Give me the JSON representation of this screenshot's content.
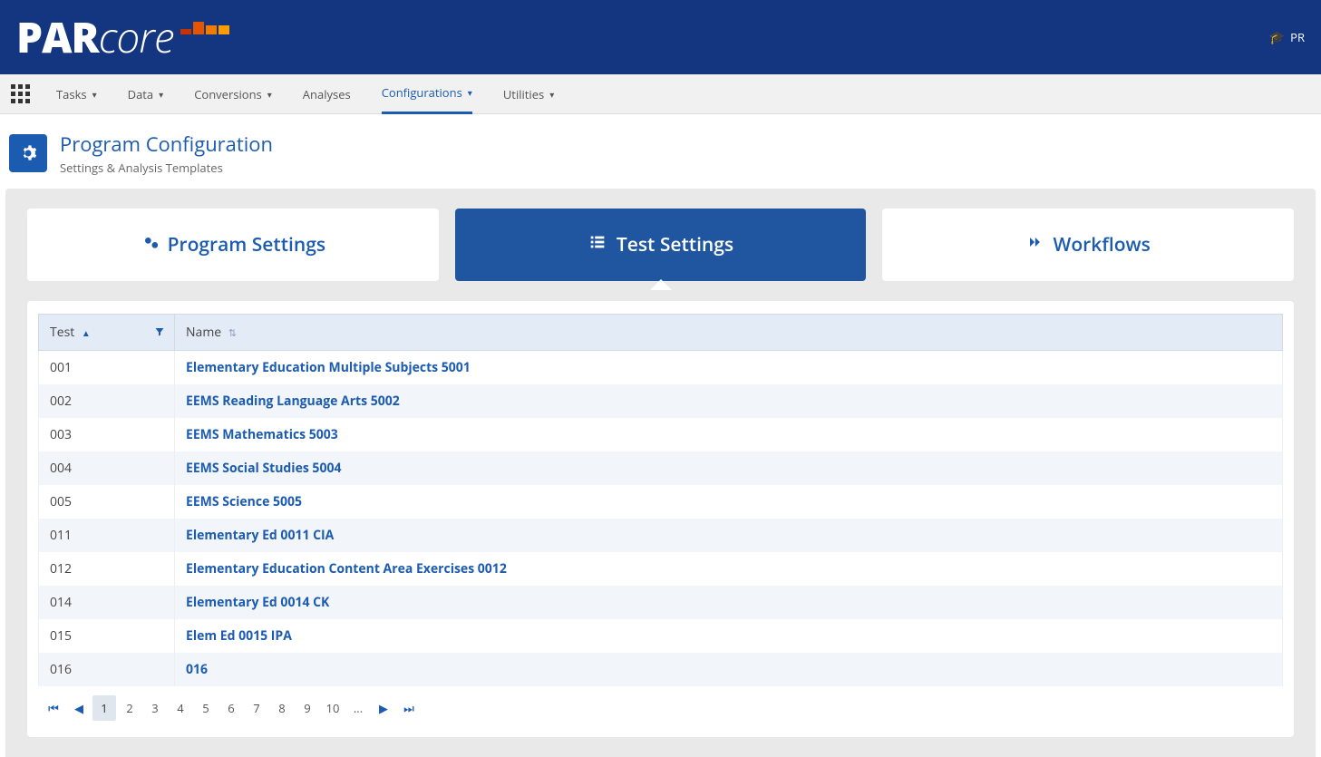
{
  "banner": {
    "logo_par": "PAR",
    "logo_core": "core",
    "user_label": "PR"
  },
  "menu": {
    "items": [
      {
        "label": "Tasks",
        "chev": true
      },
      {
        "label": "Data",
        "chev": true
      },
      {
        "label": "Conversions",
        "chev": true
      },
      {
        "label": "Analyses",
        "chev": false
      },
      {
        "label": "Configurations",
        "chev": true,
        "active": true
      },
      {
        "label": "Utilities",
        "chev": true
      }
    ]
  },
  "page": {
    "title": "Program Configuration",
    "subtitle": "Settings & Analysis Templates"
  },
  "tabs": [
    {
      "label": "Program Settings",
      "icon": "gears-icon"
    },
    {
      "label": "Test Settings",
      "icon": "list-icon",
      "active": true
    },
    {
      "label": "Workflows",
      "icon": "chevrons-icon"
    }
  ],
  "table": {
    "columns": {
      "test": "Test",
      "name": "Name"
    },
    "rows": [
      {
        "test": "001",
        "name": "Elementary Education Multiple Subjects 5001"
      },
      {
        "test": "002",
        "name": "EEMS Reading Language Arts 5002"
      },
      {
        "test": "003",
        "name": "EEMS Mathematics 5003"
      },
      {
        "test": "004",
        "name": "EEMS Social Studies 5004"
      },
      {
        "test": "005",
        "name": "EEMS Science 5005"
      },
      {
        "test": "011",
        "name": "Elementary Ed 0011 CIA"
      },
      {
        "test": "012",
        "name": "Elementary Education Content Area Exercises 0012"
      },
      {
        "test": "014",
        "name": "Elementary Ed 0014 CK"
      },
      {
        "test": "015",
        "name": "Elem Ed 0015 IPA"
      },
      {
        "test": "016",
        "name": "016"
      }
    ]
  },
  "pager": {
    "pages": [
      "1",
      "2",
      "3",
      "4",
      "5",
      "6",
      "7",
      "8",
      "9",
      "10",
      "..."
    ],
    "active": "1"
  }
}
